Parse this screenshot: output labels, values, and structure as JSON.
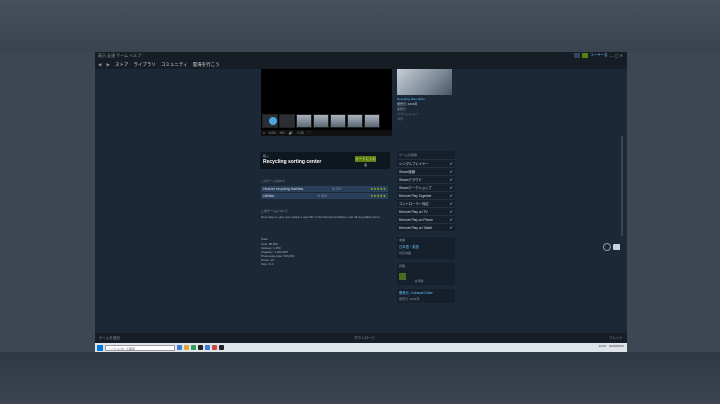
{
  "window": {
    "menu": "表示 友達 ゲーム ヘルプ",
    "user": "ユーザー名",
    "controls": "— ▢ ✕"
  },
  "nav": {
    "back": "◀",
    "forward": "▶",
    "store": "ストア",
    "library": "ライブラリ",
    "community": "コミュニティ",
    "path": "雲海を行こう"
  },
  "media": {
    "controls": [
      "⏸",
      "0:00",
      "HD",
      "🔊",
      "1:30",
      "⛶"
    ]
  },
  "right_info": {
    "tag": "Recycling Demolition",
    "lines": [
      "発売日: 2023年",
      "開発元:",
      "パブリッシャー:",
      "タグ:"
    ]
  },
  "buy": {
    "label": "購入",
    "title": "Recycling sorting center",
    "button": "カートに入れる"
  },
  "dlc": {
    "header": "このゲームのDLC",
    "rows": [
      {
        "name": "Heavier recycling facilities",
        "price": "¥ 720",
        "stars": "★★★★★"
      },
      {
        "name": "Utilities",
        "price": "¥ 410",
        "stars": "★★★★★"
      }
    ]
  },
  "description": [
    "このゲームについて",
    "New ways to give your waste a new life! In the Recycled Cabinet, sort all recyclable items.",
    "Stats",
    "Cost: 89,000",
    "Upkeep: 1,250",
    "Capacity: 1,200,000",
    "Processing rate: 500,000",
    "Noise: 10",
    "Size: 4×4"
  ],
  "features": {
    "title": "ゲームの特徴",
    "items": [
      "シングルプレイヤー",
      "Steam実績",
      "Steamクラウド",
      "Steamワークショップ",
      "Remote Play Together",
      "コントローラー対応",
      "Remote Play on TV",
      "Remote Play on Phone",
      "Remote Play on Tablet"
    ]
  },
  "language": {
    "l1": "言語",
    "v1": "日本語・英語",
    "l2": "対応言語"
  },
  "rating": {
    "label": "評価",
    "value": "全年齢"
  },
  "extra": {
    "l1": "開発元: Colossal Order",
    "l2": "発売日: 2023年"
  },
  "status": {
    "left": "ゲームを追加",
    "center": "ダウンロード",
    "right": "フレンド"
  },
  "taskbar": {
    "search": "ここに入力して検索",
    "time": "12:00",
    "date": "2023/06/01"
  }
}
